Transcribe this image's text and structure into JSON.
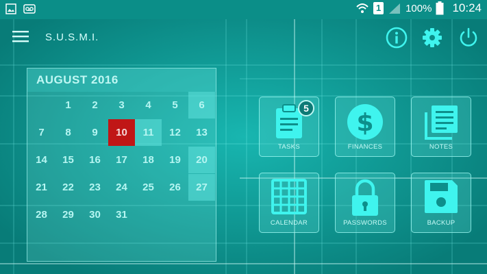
{
  "status_bar": {
    "battery": "100%",
    "time": "10:24",
    "sim_label": "1"
  },
  "app_bar": {
    "title": "S.U.S.M.I."
  },
  "calendar": {
    "title": "AUGUST 2016",
    "rows": [
      [
        "",
        "1",
        "2",
        "3",
        "4",
        "5",
        "6"
      ],
      [
        "7",
        "8",
        "9",
        "10",
        "11",
        "12",
        "13"
      ],
      [
        "14",
        "15",
        "16",
        "17",
        "18",
        "19",
        "20"
      ],
      [
        "21",
        "22",
        "23",
        "24",
        "25",
        "26",
        "27"
      ],
      [
        "28",
        "29",
        "30",
        "31",
        "",
        "",
        ""
      ]
    ],
    "today": "10"
  },
  "tiles": {
    "tasks": {
      "label": "TASKS",
      "badge": "5"
    },
    "finances": {
      "label": "FINANCES"
    },
    "notes": {
      "label": "NOTES"
    },
    "calendar": {
      "label": "CALENDAR"
    },
    "passwords": {
      "label": "PASSWORDS"
    },
    "backup": {
      "label": "BACKUP"
    }
  },
  "colors": {
    "accent": "#00e5e0",
    "today": "#c01616",
    "background": "#0a8f8c"
  }
}
